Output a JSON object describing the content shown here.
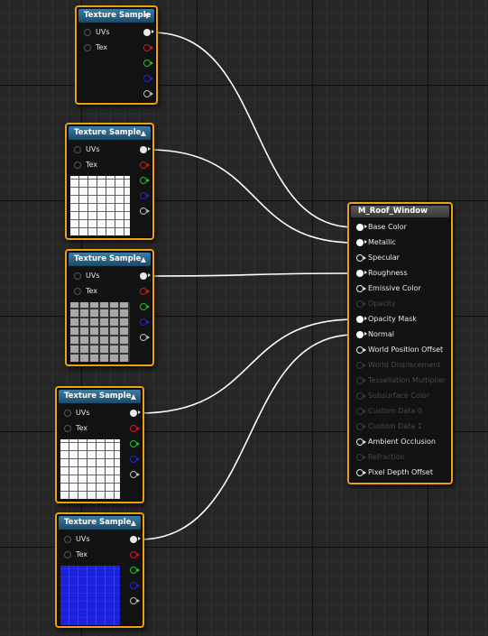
{
  "colors": {
    "node_border": "#f0a010",
    "header_blue": "#2c6a92",
    "rgb_pin": "#e8e8e8",
    "r_pin": "#d21c1c",
    "g_pin": "#22c322",
    "b_pin": "#2323dc",
    "a_pin": "#bdbdbd",
    "wire": "#ffffff"
  },
  "texture_nodes": [
    {
      "title": "Texture Sample",
      "header_icon": "collapse-down-arrow-icon",
      "inputs": [
        "UVs",
        "Tex"
      ],
      "preview": null,
      "connected_to": "Base Color"
    },
    {
      "title": "Texture Sample",
      "header_icon": "collapse-up-arrow-icon",
      "inputs": [
        "UVs",
        "Tex"
      ],
      "preview": "white-with-black-grid",
      "connected_to": "Metallic"
    },
    {
      "title": "Texture Sample",
      "header_icon": "collapse-up-arrow-icon",
      "inputs": [
        "UVs",
        "Tex"
      ],
      "preview": "gray-grid",
      "connected_to": "Roughness"
    },
    {
      "title": "Texture Sample",
      "header_icon": "collapse-up-arrow-icon",
      "inputs": [
        "UVs",
        "Tex"
      ],
      "preview": "white-grid",
      "connected_to": "Opacity Mask"
    },
    {
      "title": "Texture Sample",
      "header_icon": "collapse-up-arrow-icon",
      "inputs": [
        "UVs",
        "Tex"
      ],
      "preview": "blue-normal-map",
      "connected_to": "Normal"
    }
  ],
  "material": {
    "title": "M_Roof_Window",
    "inputs": [
      {
        "label": "Base Color",
        "state": "connected"
      },
      {
        "label": "Metallic",
        "state": "connected"
      },
      {
        "label": "Specular",
        "state": "available"
      },
      {
        "label": "Roughness",
        "state": "connected"
      },
      {
        "label": "Emissive Color",
        "state": "available"
      },
      {
        "label": "Opacity",
        "state": "disabled"
      },
      {
        "label": "Opacity Mask",
        "state": "connected"
      },
      {
        "label": "Normal",
        "state": "connected"
      },
      {
        "label": "World Position Offset",
        "state": "available"
      },
      {
        "label": "World Displacement",
        "state": "disabled"
      },
      {
        "label": "Tessellation Multiplier",
        "state": "disabled"
      },
      {
        "label": "Subsurface Color",
        "state": "disabled"
      },
      {
        "label": "Custom Data 0",
        "state": "disabled"
      },
      {
        "label": "Custom Data 1",
        "state": "disabled"
      },
      {
        "label": "Ambient Occlusion",
        "state": "available"
      },
      {
        "label": "Refraction",
        "state": "disabled"
      },
      {
        "label": "Pixel Depth Offset",
        "state": "available"
      }
    ]
  }
}
